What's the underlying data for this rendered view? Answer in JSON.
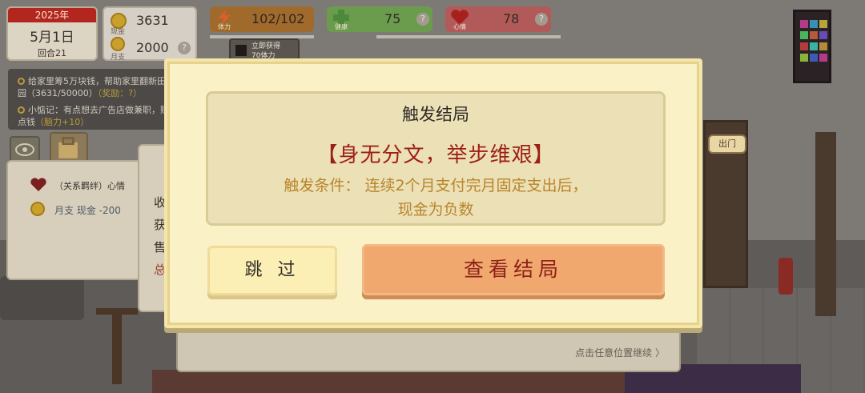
{
  "hud": {
    "year": "2025年",
    "day": "5月1日",
    "round": "回合21",
    "cash_label": "现金",
    "cash_value": "3631",
    "monthly_label": "月支",
    "monthly_value": "2000",
    "help_mark": "?",
    "energy_label": "体力",
    "energy_value": "102/102",
    "health_label": "健康",
    "health_value": "75",
    "mood_label": "心情",
    "mood_value": "78",
    "video_button": "立即获得\n70体力"
  },
  "tasks": [
    {
      "text": "给家里筹5万块钱，帮助家里翻新田园（3631/50000）",
      "reward": "（奖励：?）"
    },
    {
      "text": "小惦记：有点想去广告店做兼职，赚点钱",
      "reward": "（脑力+10）"
    }
  ],
  "side_panel": {
    "row1": "（关系羁绊）心情",
    "row2": "月支 现金 -200"
  },
  "notice_chars": [
    "收",
    "获",
    "售",
    "总"
  ],
  "scene": {
    "exit_sign": "出门",
    "continue_hint": "点击任意位置继续 〉"
  },
  "modal": {
    "title": "触发结局",
    "ending_name": "【身无分文，举步维艰】",
    "condition_line1": "触发条件：  连续2个月支付完月固定支出后，",
    "condition_line2": "现金为负数",
    "skip_button": "跳 过",
    "view_button": "查看结局"
  },
  "colors": {
    "accent_red": "#9d1f18",
    "condition_gold": "#b8852b",
    "view_button_bg": "#f0a86f",
    "skip_button_bg": "#fbefb5",
    "modal_bg": "#fbf1c7"
  }
}
